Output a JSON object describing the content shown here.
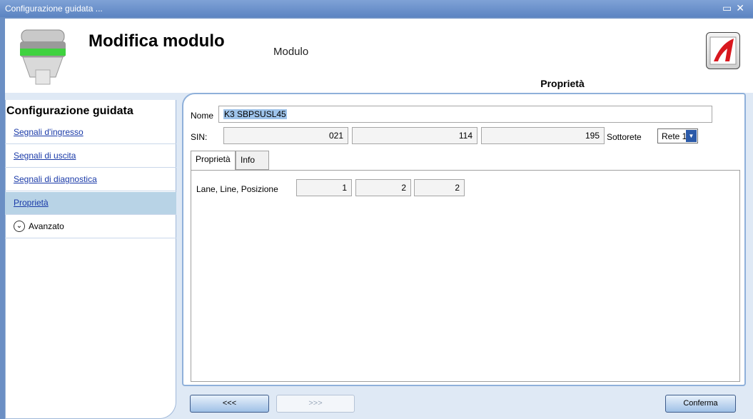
{
  "window": {
    "title": "Configurazione guidata ..."
  },
  "header": {
    "title": "Modifica modulo",
    "subtitle": "Modulo",
    "properties_tab": "Proprietà"
  },
  "sidebar": {
    "title": "Configurazione guidata",
    "items": [
      {
        "label": "Segnali d'ingresso"
      },
      {
        "label": "Segnali di uscita"
      },
      {
        "label": "Segnali di diagnostica"
      },
      {
        "label": "Proprietà"
      }
    ],
    "advanced": "Avanzato"
  },
  "form": {
    "name_label": "Nome",
    "name_value": "K3 SBPSUSL45",
    "sin_label": "SIN:",
    "sin_values": [
      "021",
      "114",
      "195"
    ],
    "subnet_label": "Sottorete",
    "subnet_value": "Rete 1"
  },
  "tabs": [
    {
      "label": "Proprietà"
    },
    {
      "label": "Info"
    }
  ],
  "properties": {
    "position_label": "Lane, Line, Posizione",
    "values": [
      "1",
      "2",
      "2"
    ]
  },
  "buttons": {
    "back": "<<<",
    "next": ">>>",
    "confirm": "Conferma"
  }
}
